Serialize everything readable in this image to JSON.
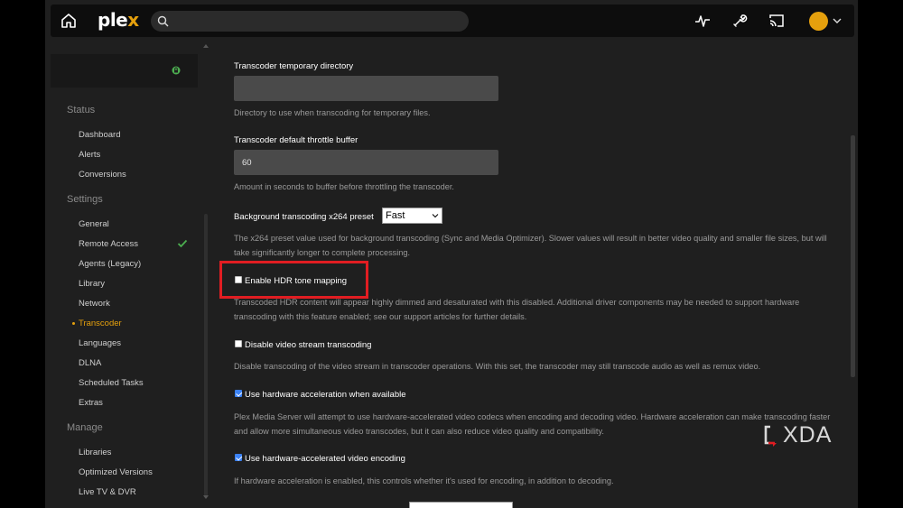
{
  "brand": {
    "logo_main": "ple",
    "logo_x": "x",
    "accent": "#e5a00d"
  },
  "topbar": {
    "search_placeholder": "",
    "icons": [
      "home-icon",
      "search-icon",
      "activity-icon",
      "settings-wrench-icon",
      "cast-icon",
      "avatar",
      "chevron-down-icon"
    ]
  },
  "sidebar": {
    "status_title": "Status",
    "status_items": [
      "Dashboard",
      "Alerts",
      "Conversions"
    ],
    "settings_title": "Settings",
    "settings_items": [
      "General",
      "Remote Access",
      "Agents (Legacy)",
      "Library",
      "Network",
      "Transcoder",
      "Languages",
      "DLNA",
      "Scheduled Tasks",
      "Extras"
    ],
    "active_item": "Transcoder",
    "manage_title": "Manage",
    "manage_items": [
      "Libraries",
      "Optimized Versions",
      "Live TV & DVR"
    ]
  },
  "settings": {
    "temp_dir": {
      "label": "Transcoder temporary directory",
      "value": "",
      "help": "Directory to use when transcoding for temporary files."
    },
    "throttle": {
      "label": "Transcoder default throttle buffer",
      "value": "60",
      "help": "Amount in seconds to buffer before throttling the transcoder."
    },
    "x264_preset": {
      "label": "Background transcoding x264 preset",
      "value": "Fast",
      "help": "The x264 preset value used for background transcoding (Sync and Media Optimizer). Slower values will result in better video quality and smaller file sizes, but will take significantly longer to complete processing."
    },
    "hdr": {
      "label": "Enable HDR tone mapping",
      "checked": false,
      "help": "Transcoded HDR content will appear highly dimmed and desaturated with this disabled. Additional driver components may be needed to support hardware transcoding with this feature enabled; see our support articles for further details."
    },
    "disable_video": {
      "label": "Disable video stream transcoding",
      "checked": false,
      "help": "Disable transcoding of the video stream in transcoder operations. With this set, the transcoder may still transcode audio as well as remux video."
    },
    "hw_accel": {
      "label": "Use hardware acceleration when available",
      "checked": true,
      "help": "Plex Media Server will attempt to use hardware-accelerated video codecs when encoding and decoding video. Hardware acceleration can make transcoding faster and allow more simultaneous video transcodes, but it can also reduce video quality and compatibility."
    },
    "hw_encode": {
      "label": "Use hardware-accelerated video encoding",
      "checked": true,
      "help": "If hardware acceleration is enabled, this controls whether it's used for encoding, in addition to decoding."
    }
  },
  "watermark": {
    "text": "XDA"
  },
  "colors": {
    "highlight": "#e11d22",
    "checkbox_checked": "#3b82f6",
    "ok_green": "#4caf50"
  }
}
